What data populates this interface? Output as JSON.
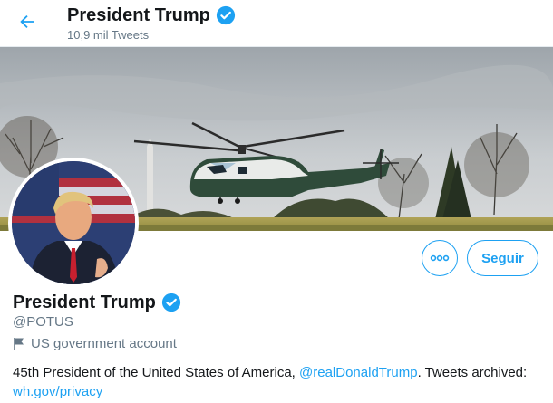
{
  "header": {
    "back_icon": "arrow-left-icon",
    "name": "President Trump",
    "tweet_count": "10,9 mil Tweets"
  },
  "profile": {
    "name": "President Trump",
    "handle": "@POTUS",
    "account_label": "US government account",
    "account_label_icon": "flag-icon",
    "verified_icon": "verified-badge-icon",
    "bio": {
      "text_before": "45th President of the United States of America, ",
      "mention": "@realDonaldTrump",
      "text_after": ". Tweets archived:",
      "link": "wh.gov/privacy"
    }
  },
  "actions": {
    "more_icon": "more-icon",
    "follow_label": "Seguir"
  },
  "colors": {
    "accent": "#1da1f2",
    "text": "#14171a",
    "secondary_text": "#657786"
  }
}
